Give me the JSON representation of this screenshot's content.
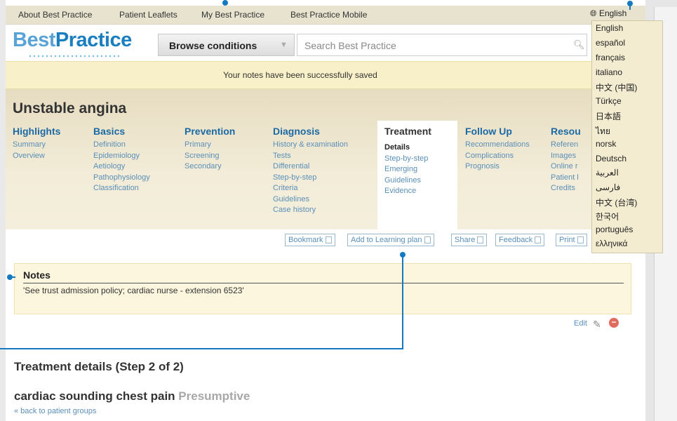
{
  "topnav": [
    "About Best Practice",
    "Patient Leaflets",
    "My Best Practice",
    "Best Practice Mobile"
  ],
  "brand": {
    "part1": "Best",
    "part2": "Practice"
  },
  "browse": {
    "label": "Browse conditions",
    "arrow": "▼"
  },
  "search": {
    "placeholder": "Search Best Practice"
  },
  "notice": "Your notes have been successfully saved",
  "topic": {
    "title": "Unstable angina"
  },
  "sections": {
    "highlights": {
      "title": "Highlights",
      "items": [
        "Summary",
        "Overview"
      ]
    },
    "basics": {
      "title": "Basics",
      "items": [
        "Definition",
        "Epidemiology",
        "Aetiology",
        "Pathophysiology",
        "Classification"
      ]
    },
    "prevention": {
      "title": "Prevention",
      "items": [
        "Primary",
        "Screening",
        "Secondary"
      ]
    },
    "diagnosis": {
      "title": "Diagnosis",
      "items": [
        "History & examination",
        "Tests",
        "Differential",
        "Step-by-step",
        "Criteria",
        "Guidelines",
        "Case history"
      ]
    },
    "treatment": {
      "title": "Treatment",
      "items": [
        "Details",
        "Step-by-step",
        "Emerging",
        "Guidelines",
        "Evidence"
      ]
    },
    "followup": {
      "title": "Follow Up",
      "items": [
        "Recommendations",
        "Complications",
        "Prognosis"
      ]
    },
    "resources": {
      "title": "Resou",
      "items": [
        "Referen",
        "Images",
        "Online r",
        "Patient l",
        "Credits"
      ]
    }
  },
  "actions": [
    "Bookmark",
    "Add to Learning plan",
    "Share",
    "Feedback",
    "Print"
  ],
  "notes": {
    "heading": "Notes",
    "text": "'See trust admission policy; cardiac nurse - extension 6523'"
  },
  "edit": "Edit",
  "section_title": "Treatment details (Step 2 of 2)",
  "group": {
    "title": "cardiac sounding chest pain",
    "status": "Presumptive",
    "back": "« back to patient groups"
  },
  "language": {
    "current": "English",
    "options": [
      "English",
      "español",
      "français",
      "italiano",
      "中文 (中国)",
      "Türkçe",
      "日本語",
      "ไทย",
      "norsk",
      "Deutsch",
      "العربية",
      "فارسی",
      "中文 (台湾)",
      "한국어",
      "português",
      "ελληνικά"
    ]
  },
  "colors": {
    "link": "#5b8fb8",
    "heading": "#1b6aa5",
    "notice": "#f8f0c8",
    "callout": "#1579c0"
  }
}
